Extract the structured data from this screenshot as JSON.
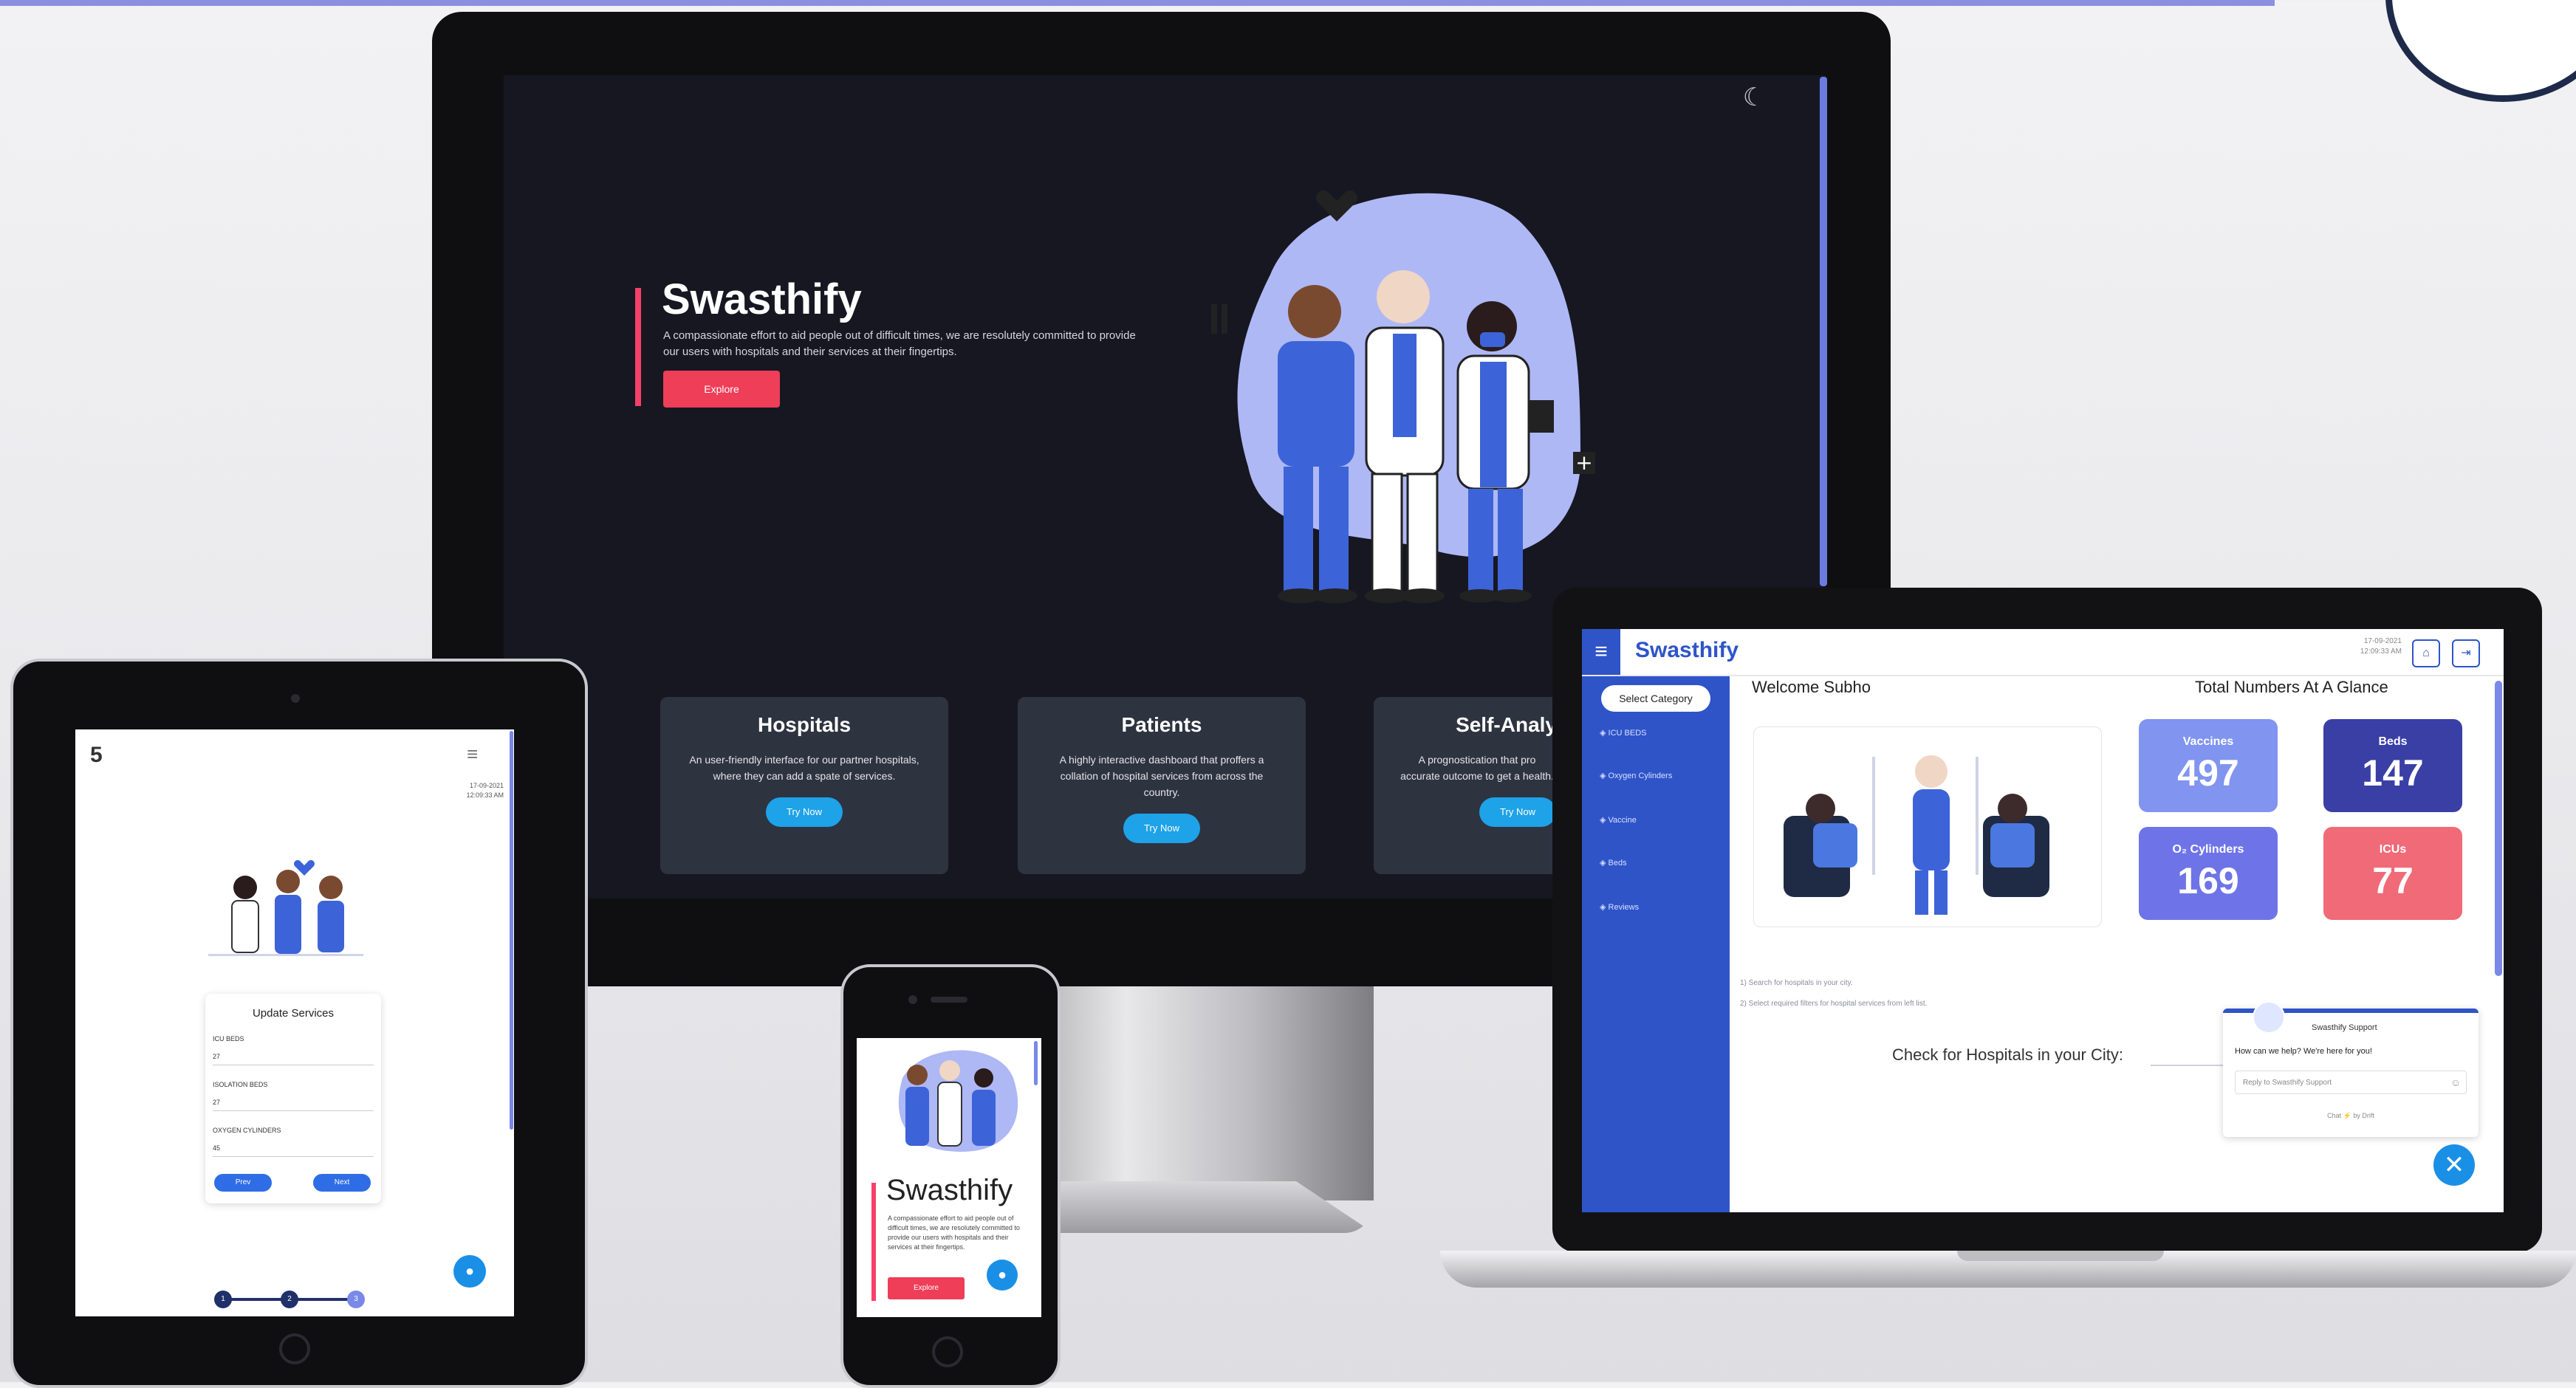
{
  "desktop": {
    "hero": {
      "title": "Swasthify",
      "description": "A compassionate effort to aid people out of difficult times, we are resolutely committed to provide our users with hospitals and their services at their fingertips.",
      "button": "Explore"
    },
    "cards": [
      {
        "title": "Hospitals",
        "text": "An user-friendly interface for our partner hospitals, where they can add a spate of services.",
        "button": "Try Now"
      },
      {
        "title": "Patients",
        "text": "A highly interactive dashboard that proffers a collation of hospital services from across the country.",
        "button": "Try Now"
      },
      {
        "title": "Self-Analy",
        "text": "A prognostication that pro accurate outcome to get a health.",
        "button": "Try Now"
      }
    ]
  },
  "laptop": {
    "logo": "Swasthify",
    "date": "17-09-2021",
    "time": "12:09:33 AM",
    "select_category": "Select Category",
    "nav": [
      "ICU BEDS",
      "Oxygen Cylinders",
      "Vaccine",
      "Beds",
      "Reviews"
    ],
    "welcome": "Welcome Subho",
    "totals_heading": "Total Numbers At A Glance",
    "tiles": [
      {
        "label": "Vaccines",
        "value": "497",
        "color": "#8094f0"
      },
      {
        "label": "Beds",
        "value": "147",
        "color": "#3a3fa6"
      },
      {
        "label": "O₂ Cylinders",
        "value": "169",
        "color": "#6e74e8"
      },
      {
        "label": "ICUs",
        "value": "77",
        "color": "#f06a78"
      }
    ],
    "steps": [
      "1) Search for hospitals in your city.",
      "2) Select required filters for hospital services from left list."
    ],
    "check": "Check for Hospitals in your City:",
    "chat": {
      "name": "Swasthify Support",
      "question": "How can we help? We're here for you!",
      "placeholder": "Reply to Swasthify Support",
      "footer": "Chat ⚡ by Drift"
    }
  },
  "tablet": {
    "date": "17-09-2021",
    "time": "12:09:33 AM",
    "form": {
      "title": "Update Services",
      "fields": [
        {
          "label": "ICU BEDS",
          "value": "27"
        },
        {
          "label": "ISOLATION BEDS",
          "value": "27"
        },
        {
          "label": "OXYGEN CYLINDERS",
          "value": "45"
        }
      ],
      "prev": "Prev",
      "next": "Next"
    },
    "steps": [
      "1",
      "2",
      "3"
    ]
  },
  "phone": {
    "title": "Swasthify",
    "description": "A compassionate effort to aid people out of difficult times, we are resolutely committed to provide our users with hospitals and their services at their fingertips.",
    "button": "Explore"
  },
  "colors": {
    "accent": "#2e54c8",
    "brand_pink": "#ee3e58",
    "button_blue": "#1ea2e8",
    "hero_bg": "#171722"
  }
}
